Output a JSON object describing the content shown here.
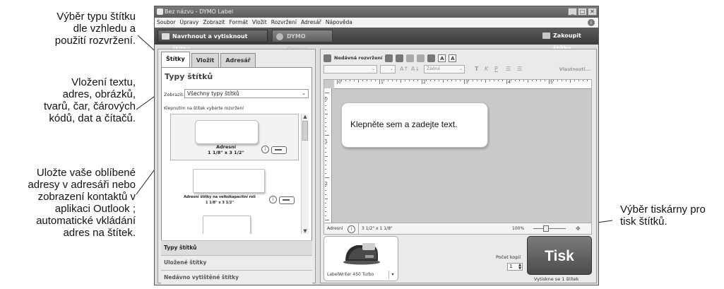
{
  "annotations": {
    "label_type": "Výběr typu štítku\ndle vzhledu a\npoužití rozvržení.",
    "insert": "Vložení textu,\nadres, obrázků,\ntvarů, čar, čárových\nkódů, dat a čítačů.",
    "address": "Uložte vaše oblíbené\nadresy v adresáři nebo\nzobrazení kontaktů v\naplikaci Outlook ;\nautomatické vkládání\nadres na štítek.",
    "printer": "Výběr tiskárny pro\ntisk štítků."
  },
  "window": {
    "title": "Bez názvu - DYMO Label"
  },
  "menu": [
    "Soubor",
    "Úpravy",
    "Zobrazit",
    "Formát",
    "Vložit",
    "Rozvržení",
    "Adresář",
    "Nápověda"
  ],
  "toolbar": {
    "design_print": "Navrhnout a vytisknout štítky",
    "online": "DYMO Online",
    "buy": "Zakoupit štítky"
  },
  "left": {
    "tabs": [
      "Štítky",
      "Vložit",
      "Adresář"
    ],
    "title": "Typy štítků",
    "show_label": "Zobrazit:",
    "show_value": "Všechny typy štítků",
    "hint": "Klepnutím na štítek vyberte rozvržení",
    "labels": [
      {
        "name_line1": "Adresní",
        "name_line2": "1 1/8\" x 3 1/2\""
      },
      {
        "name_line1": "Adresní štítky na velkokapacitní roli",
        "name_line2": "1 1/8\" x 3 1/2\""
      }
    ],
    "sections": [
      "Typy štítků",
      "Uložené štítky",
      "Nedávno vytištěné štítky"
    ]
  },
  "right": {
    "recent_layouts": "Nedávná rozvržení",
    "font_style_value": "Žádné",
    "properties": "Vlastnosti...",
    "ruler_marks": [
      "0",
      "1",
      "2",
      "3",
      "4",
      "5"
    ],
    "ruler_left_marks": [
      "0",
      "1",
      "2"
    ],
    "editor_text": "Klepněte sem a zadejte text.",
    "status_label": "Adresní",
    "status_size": "3 1/2\" x 1 1/8\"",
    "zoom": "100%",
    "printer_name": "LabelWriter 450 Turbo",
    "copies_label": "Počet kopií",
    "copies_value": "1",
    "print_button": "Tisk",
    "print_caption": "Vytiskne se 1 štítek"
  },
  "colors": {
    "toolbar_dark": "#4b4b4b",
    "print_button": "#5f5f5f"
  }
}
